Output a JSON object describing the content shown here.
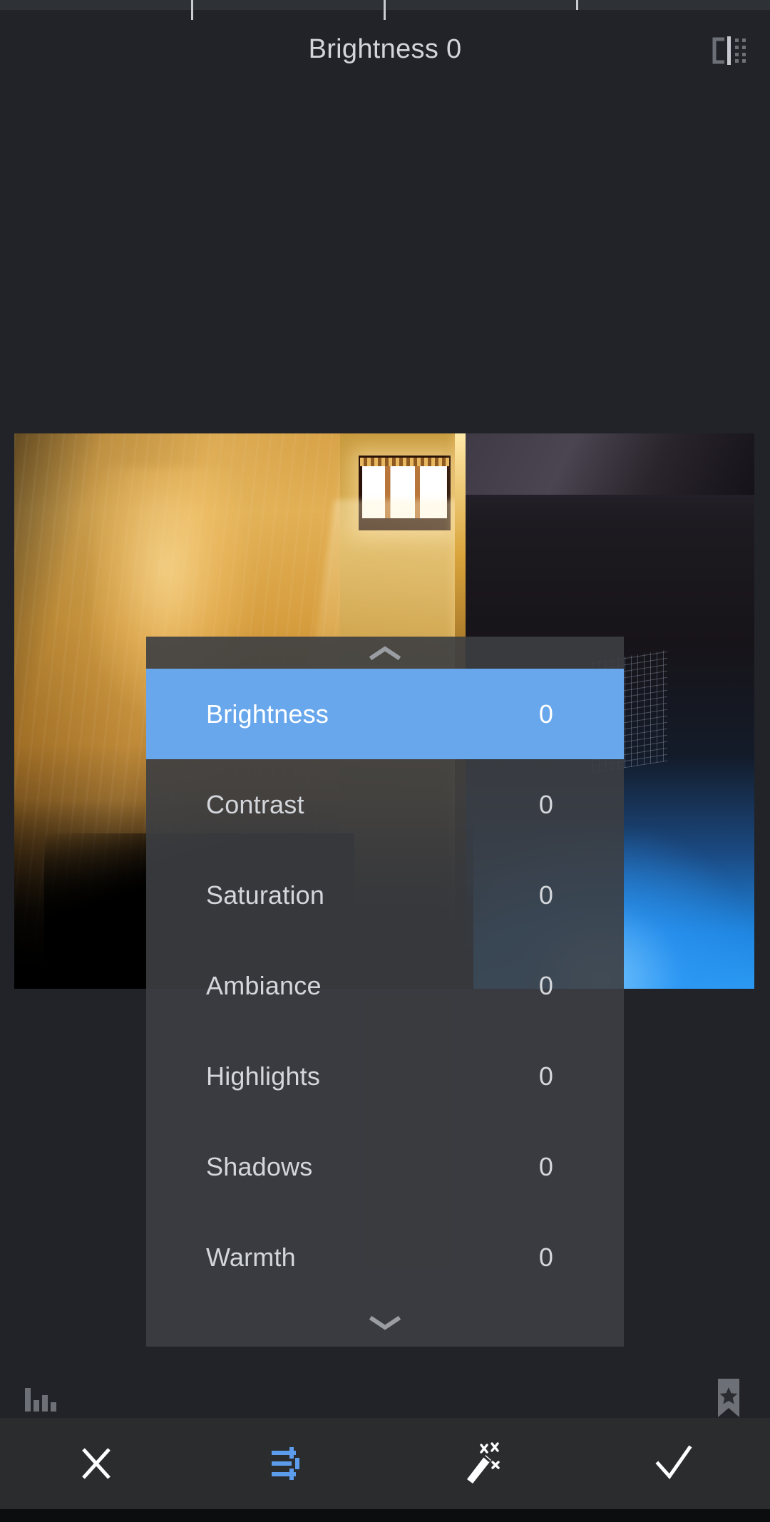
{
  "app": {
    "background_color": "#212328",
    "toolbar_color": "#2b2c2e",
    "accent_color": "#68a7ec",
    "text_color": "#d3d6da"
  },
  "status_bar": {
    "ticks": [
      "tick-1",
      "tick-2",
      "tick-3"
    ]
  },
  "header": {
    "title": "Brightness 0",
    "adjustment_name": "Brightness",
    "adjustment_value": "0",
    "compare_button_label": "Compare",
    "compare_icon": "compare-icon"
  },
  "photo": {
    "alt": "Interior room with sunlit golden wall, bright barred window and dark right side with blue light",
    "icon": "photo-preview"
  },
  "panel": {
    "expand_up_icon": "chevron-up-icon",
    "expand_down_icon": "chevron-down-icon",
    "options": [
      {
        "label": "Brightness",
        "value": "0",
        "selected": true
      },
      {
        "label": "Contrast",
        "value": "0",
        "selected": false
      },
      {
        "label": "Saturation",
        "value": "0",
        "selected": false
      },
      {
        "label": "Ambiance",
        "value": "0",
        "selected": false
      },
      {
        "label": "Highlights",
        "value": "0",
        "selected": false
      },
      {
        "label": "Shadows",
        "value": "0",
        "selected": false
      },
      {
        "label": "Warmth",
        "value": "0",
        "selected": false
      }
    ]
  },
  "icon_bar": {
    "histogram_label": "Histogram",
    "histogram_icon": "histogram-icon",
    "presets_label": "Presets",
    "presets_icon": "bookmark-star-icon"
  },
  "toolbar": {
    "items": [
      {
        "label": "Cancel",
        "icon": "close-x-icon",
        "active": false
      },
      {
        "label": "Tune Image",
        "icon": "sliders-icon",
        "active": true
      },
      {
        "label": "Auto",
        "icon": "magic-wand-icon",
        "active": false
      },
      {
        "label": "Apply",
        "icon": "check-icon",
        "active": false
      }
    ]
  }
}
